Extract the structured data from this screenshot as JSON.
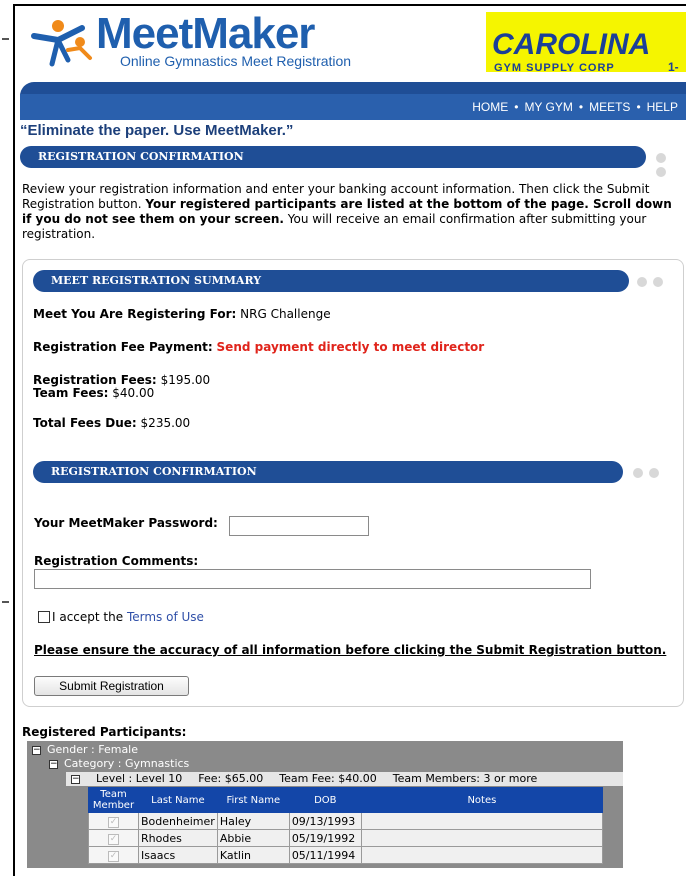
{
  "header": {
    "logo_title": "MeetMaker",
    "logo_subtitle": "Online Gymnastics Meet Registration",
    "ad_brand": "CAROLINA",
    "ad_sub": "GYM SUPPLY CORP",
    "ad_num": "1-",
    "brand_color": "#1f5fae"
  },
  "nav": {
    "home": "HOME",
    "my_gym": "MY GYM",
    "meets": "MEETS",
    "help": "HELP",
    "separator": "•"
  },
  "tagline": "“Eliminate the paper. Use MeetMaker.”",
  "confirmation_bar": "REGISTRATION CONFIRMATION",
  "intro": {
    "part1": "Review your registration information and enter your banking account information. Then click the Submit Registration button. ",
    "bold": "Your registered participants are listed at the bottom of the page. Scroll down if you do not see them on your screen.",
    "part2": " You will receive an email confirmation after submitting your registration."
  },
  "summary": {
    "bar": "MEET REGISTRATION SUMMARY",
    "meet_label": "Meet You Are Registering For:",
    "meet_value": "NRG Challenge",
    "payment_label": "Registration Fee Payment:",
    "payment_value": "Send payment directly to meet director",
    "reg_fees_label": "Registration Fees:",
    "reg_fees_value": "$195.00",
    "team_fees_label": "Team Fees:",
    "team_fees_value": "$40.00",
    "total_label": "Total Fees Due:",
    "total_value": "$235.00"
  },
  "confirm": {
    "bar": "REGISTRATION CONFIRMATION",
    "password_label": "Your MeetMaker Password:",
    "password_value": "",
    "comments_label": "Registration Comments:",
    "comments_value": "",
    "accept_prefix": "I accept the",
    "terms_link": "Terms of Use",
    "warning": "Please ensure the accuracy of all information before clicking the Submit Registration button.",
    "submit_label": "Submit Registration"
  },
  "participants": {
    "title": "Registered Participants:",
    "gender": "Gender : Female",
    "category": "Category : Gymnastics",
    "level": "Level : Level 10",
    "fee": "Fee: $65.00",
    "team_fee": "Team Fee: $40.00",
    "team_members": "Team Members: 3 or more",
    "columns": [
      "Team Member",
      "Last Name",
      "First Name",
      "DOB",
      "Notes"
    ],
    "rows": [
      {
        "last": "Bodenheimer",
        "first": "Haley",
        "dob": "09/13/1993",
        "notes": ""
      },
      {
        "last": "Rhodes",
        "first": "Abbie",
        "dob": "05/19/1992",
        "notes": ""
      },
      {
        "last": "Isaacs",
        "first": "Katlin",
        "dob": "05/11/1994",
        "notes": ""
      }
    ]
  }
}
